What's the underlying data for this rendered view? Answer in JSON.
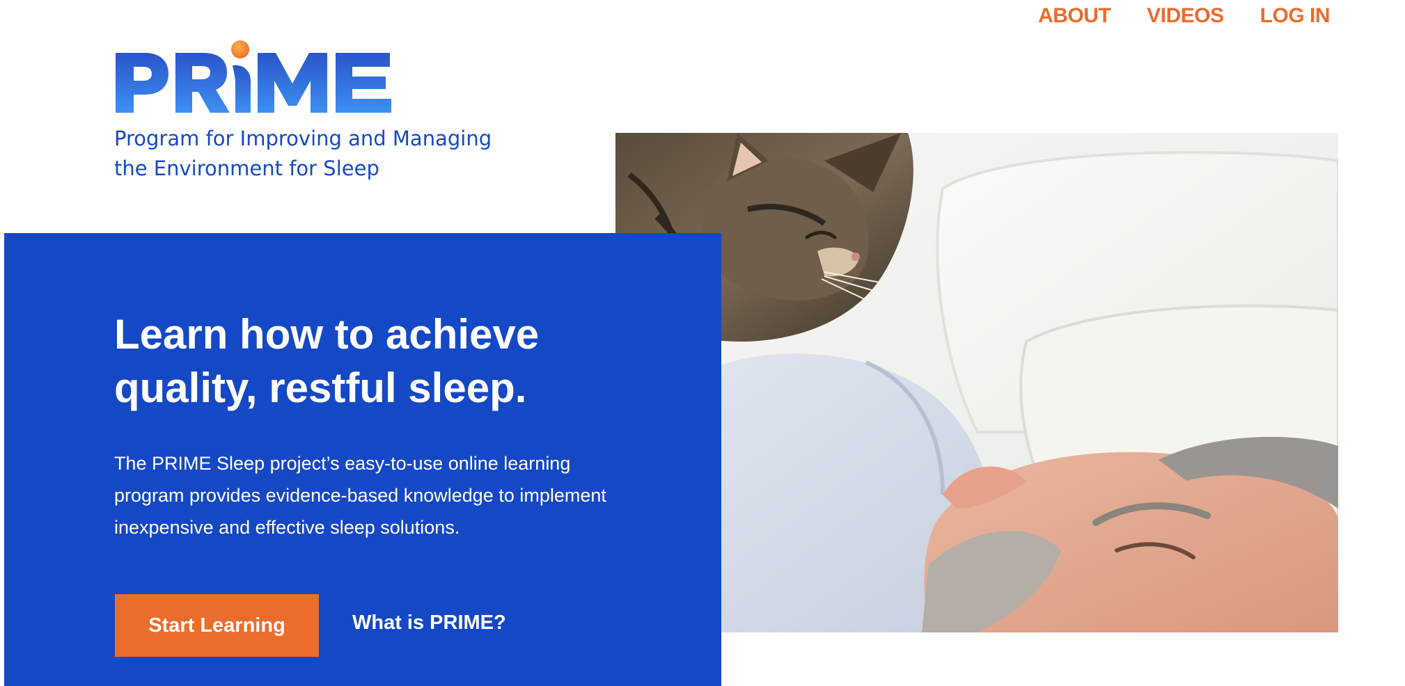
{
  "nav": {
    "items": [
      {
        "label": "ABOUT"
      },
      {
        "label": "VIDEOS"
      },
      {
        "label": "LOG IN"
      }
    ]
  },
  "brand": {
    "logo_text": "PRIME",
    "tagline_line1": "Program for Improving and Managing",
    "tagline_line2": "the Environment for Sleep"
  },
  "hero": {
    "heading_line1": "Learn how to achieve",
    "heading_line2": "quality, restful sleep.",
    "body": "The PRIME Sleep project’s easy-to-use online learning program provides evidence-based knowledge to implement inexpensive and effective sleep solutions.",
    "primary_button": "Start Learning",
    "secondary_link": "What is PRIME?"
  },
  "colors": {
    "accent_orange": "#ec6c2c",
    "brand_blue": "#1548c5",
    "tagline_blue": "#1848c2",
    "background": "#ffffff"
  },
  "image": {
    "subject": "cat-resting-on-sleeping-man"
  }
}
